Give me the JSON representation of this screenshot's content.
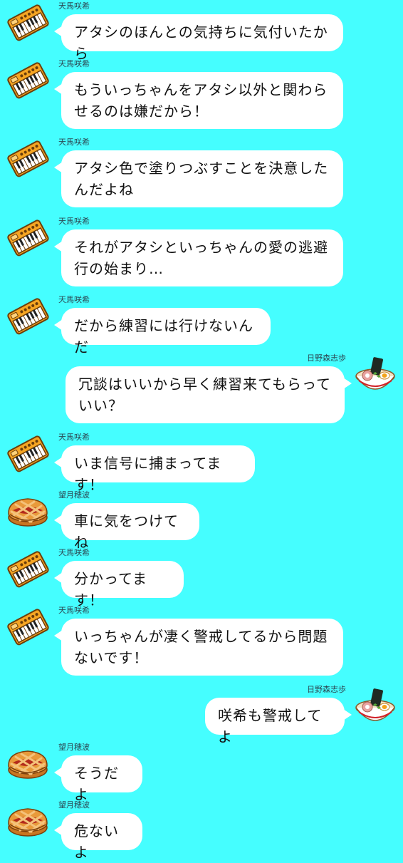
{
  "colors": {
    "background": "#45feff",
    "bubble": "#ffffff"
  },
  "senders": {
    "saki": {
      "name": "天馬咲希",
      "icon": "keyboard-icon"
    },
    "shiho": {
      "name": "日野森志歩",
      "icon": "ramen-icon"
    },
    "honami": {
      "name": "望月穂波",
      "icon": "pie-icon"
    }
  },
  "messages": [
    {
      "sender": "天馬咲希",
      "text": "アタシのほんとの気持ちに気付いたから"
    },
    {
      "sender": "天馬咲希",
      "text": "もういっちゃんをアタシ以外と関わらせるのは嫌だから！"
    },
    {
      "sender": "天馬咲希",
      "text": "アタシ色で塗りつぶすことを決意したんだよね"
    },
    {
      "sender": "天馬咲希",
      "text": "それがアタシといっちゃんの愛の逃避行の始まり…"
    },
    {
      "sender": "天馬咲希",
      "text": "だから練習には行けないんだ"
    },
    {
      "sender": "日野森志歩",
      "text": "冗談はいいから早く練習来てもらっていい？"
    },
    {
      "sender": "天馬咲希",
      "text": "いま信号に捕まってます！"
    },
    {
      "sender": "望月穂波",
      "text": "車に気をつけてね"
    },
    {
      "sender": "天馬咲希",
      "text": "分かってます！"
    },
    {
      "sender": "天馬咲希",
      "text": "いっちゃんが凄く警戒してるから問題ないです！"
    },
    {
      "sender": "日野森志歩",
      "text": "咲希も警戒してよ"
    },
    {
      "sender": "望月穂波",
      "text": "そうだよ"
    },
    {
      "sender": "望月穂波",
      "text": "危ないよ"
    }
  ]
}
